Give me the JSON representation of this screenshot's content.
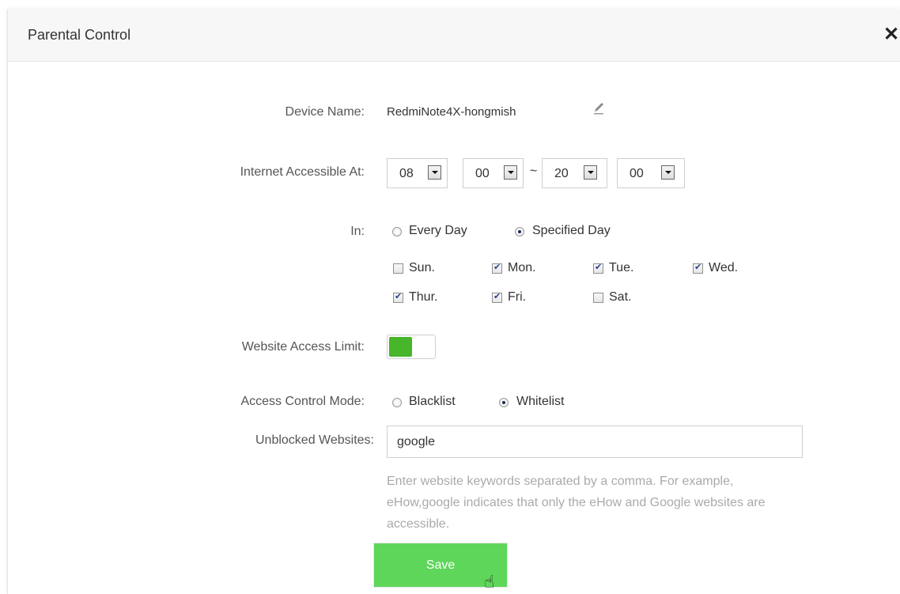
{
  "dialog": {
    "title": "Parental Control",
    "close_glyph": "✕"
  },
  "form": {
    "device_name_label": "Device Name:",
    "device_name_value": "RedmiNote4X-hongmish",
    "edit_icon": "pencil-icon",
    "access_time_label": "Internet Accessible At:",
    "start_hour": "08",
    "start_minute": "00",
    "separator": "~",
    "end_hour": "20",
    "end_minute": "00",
    "in_label": "In:",
    "every_day_label": "Every Day",
    "specified_day_label": "Specified Day",
    "day_mode_selected": "Specified Day",
    "days": [
      {
        "label": "Sun.",
        "checked": false
      },
      {
        "label": "Mon.",
        "checked": true
      },
      {
        "label": "Tue.",
        "checked": true
      },
      {
        "label": "Wed.",
        "checked": true
      },
      {
        "label": "Thur.",
        "checked": true
      },
      {
        "label": "Fri.",
        "checked": true
      },
      {
        "label": "Sat.",
        "checked": false
      }
    ],
    "website_limit_label": "Website Access Limit:",
    "website_limit_enabled": true,
    "mode_label": "Access Control Mode:",
    "blacklist_label": "Blacklist",
    "whitelist_label": "Whitelist",
    "mode_selected": "Whitelist",
    "unblocked_label": "Unblocked Websites:",
    "unblocked_value": "google",
    "hint": "Enter website keywords separated by a comma. For example, eHow,google indicates that only the eHow and Google websites are accessible.",
    "save_label": "Save"
  },
  "colors": {
    "toggle_on": "#47b62a",
    "save_button": "#5ed65a",
    "hint_text": "#aaaaaa"
  }
}
